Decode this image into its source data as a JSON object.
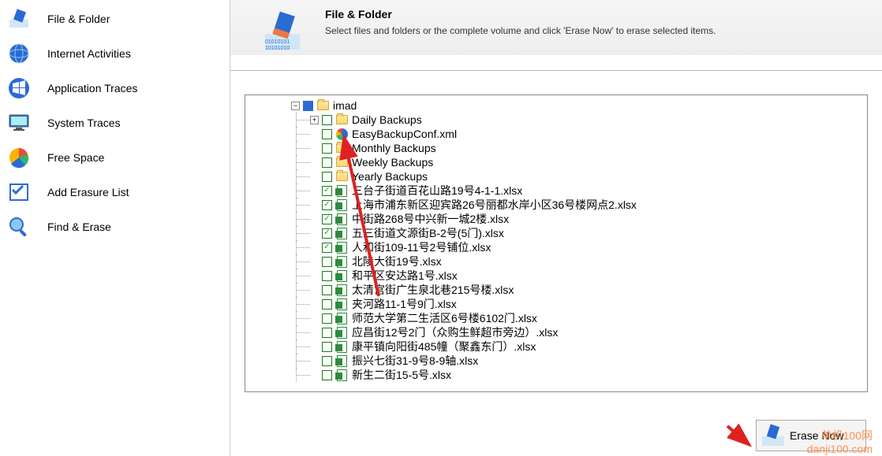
{
  "sidebar": {
    "items": [
      {
        "label": "File & Folder",
        "icon": "eraser"
      },
      {
        "label": "Internet Activities",
        "icon": "globe"
      },
      {
        "label": "Application Traces",
        "icon": "win"
      },
      {
        "label": "System Traces",
        "icon": "monitor"
      },
      {
        "label": "Free Space",
        "icon": "pie"
      },
      {
        "label": "Add Erasure List",
        "icon": "check"
      },
      {
        "label": "Find & Erase",
        "icon": "search"
      }
    ]
  },
  "header": {
    "title": "File & Folder",
    "subtitle": "Select files and folders or the complete volume and click 'Erase Now' to erase selected items."
  },
  "tree": {
    "root": {
      "label": "imad",
      "expanded": true,
      "checked": "filled"
    },
    "children": [
      {
        "type": "folder",
        "label": "Daily Backups",
        "expandable": true,
        "checked": false,
        "icon": "folder"
      },
      {
        "type": "file",
        "label": "EasyBackupConf.xml",
        "checked": false,
        "icon": "edge"
      },
      {
        "type": "folder",
        "label": "Monthly Backups",
        "checked": false,
        "icon": "folder"
      },
      {
        "type": "folder",
        "label": "Weekly Backups",
        "checked": false,
        "icon": "folder"
      },
      {
        "type": "folder",
        "label": "Yearly Backups",
        "checked": false,
        "icon": "folder"
      },
      {
        "type": "file",
        "label": "三台子街道百花山路19号4-1-1.xlsx",
        "checked": true,
        "icon": "xlsx"
      },
      {
        "type": "file",
        "label": "上海市浦东新区迎宾路26号丽都水岸小区36号楼网点2.xlsx",
        "checked": true,
        "icon": "xlsx"
      },
      {
        "type": "file",
        "label": "中街路268号中兴新一城2楼.xlsx",
        "checked": true,
        "icon": "xlsx"
      },
      {
        "type": "file",
        "label": "五三街道文源街B-2号(5门).xlsx",
        "checked": true,
        "icon": "xlsx"
      },
      {
        "type": "file",
        "label": "人和街109-11号2号铺位.xlsx",
        "checked": true,
        "icon": "xlsx"
      },
      {
        "type": "file",
        "label": "北陵大街19号.xlsx",
        "checked": false,
        "icon": "xlsx"
      },
      {
        "type": "file",
        "label": "和平区安达路1号.xlsx",
        "checked": false,
        "icon": "xlsx"
      },
      {
        "type": "file",
        "label": "太清宫街广生泉北巷215号楼.xlsx",
        "checked": false,
        "icon": "xlsx"
      },
      {
        "type": "file",
        "label": "夹河路11-1号9门.xlsx",
        "checked": false,
        "icon": "xlsx"
      },
      {
        "type": "file",
        "label": "师范大学第二生活区6号楼6102门.xlsx",
        "checked": false,
        "icon": "xlsx"
      },
      {
        "type": "file",
        "label": "应昌街12号2门（众购生鲜超市旁边）.xlsx",
        "checked": false,
        "icon": "xlsx"
      },
      {
        "type": "file",
        "label": "康平镇向阳街485幢（聚鑫东门）.xlsx",
        "checked": false,
        "icon": "xlsx"
      },
      {
        "type": "file",
        "label": "振兴七街31-9号8-9轴.xlsx",
        "checked": false,
        "icon": "xlsx"
      },
      {
        "type": "file",
        "label": "新生二街15-5号.xlsx",
        "checked": false,
        "icon": "xlsx"
      }
    ]
  },
  "buttons": {
    "erase_now": "Erase Now"
  },
  "watermark": {
    "line1": "单机100网",
    "line2": "danji100.com"
  }
}
